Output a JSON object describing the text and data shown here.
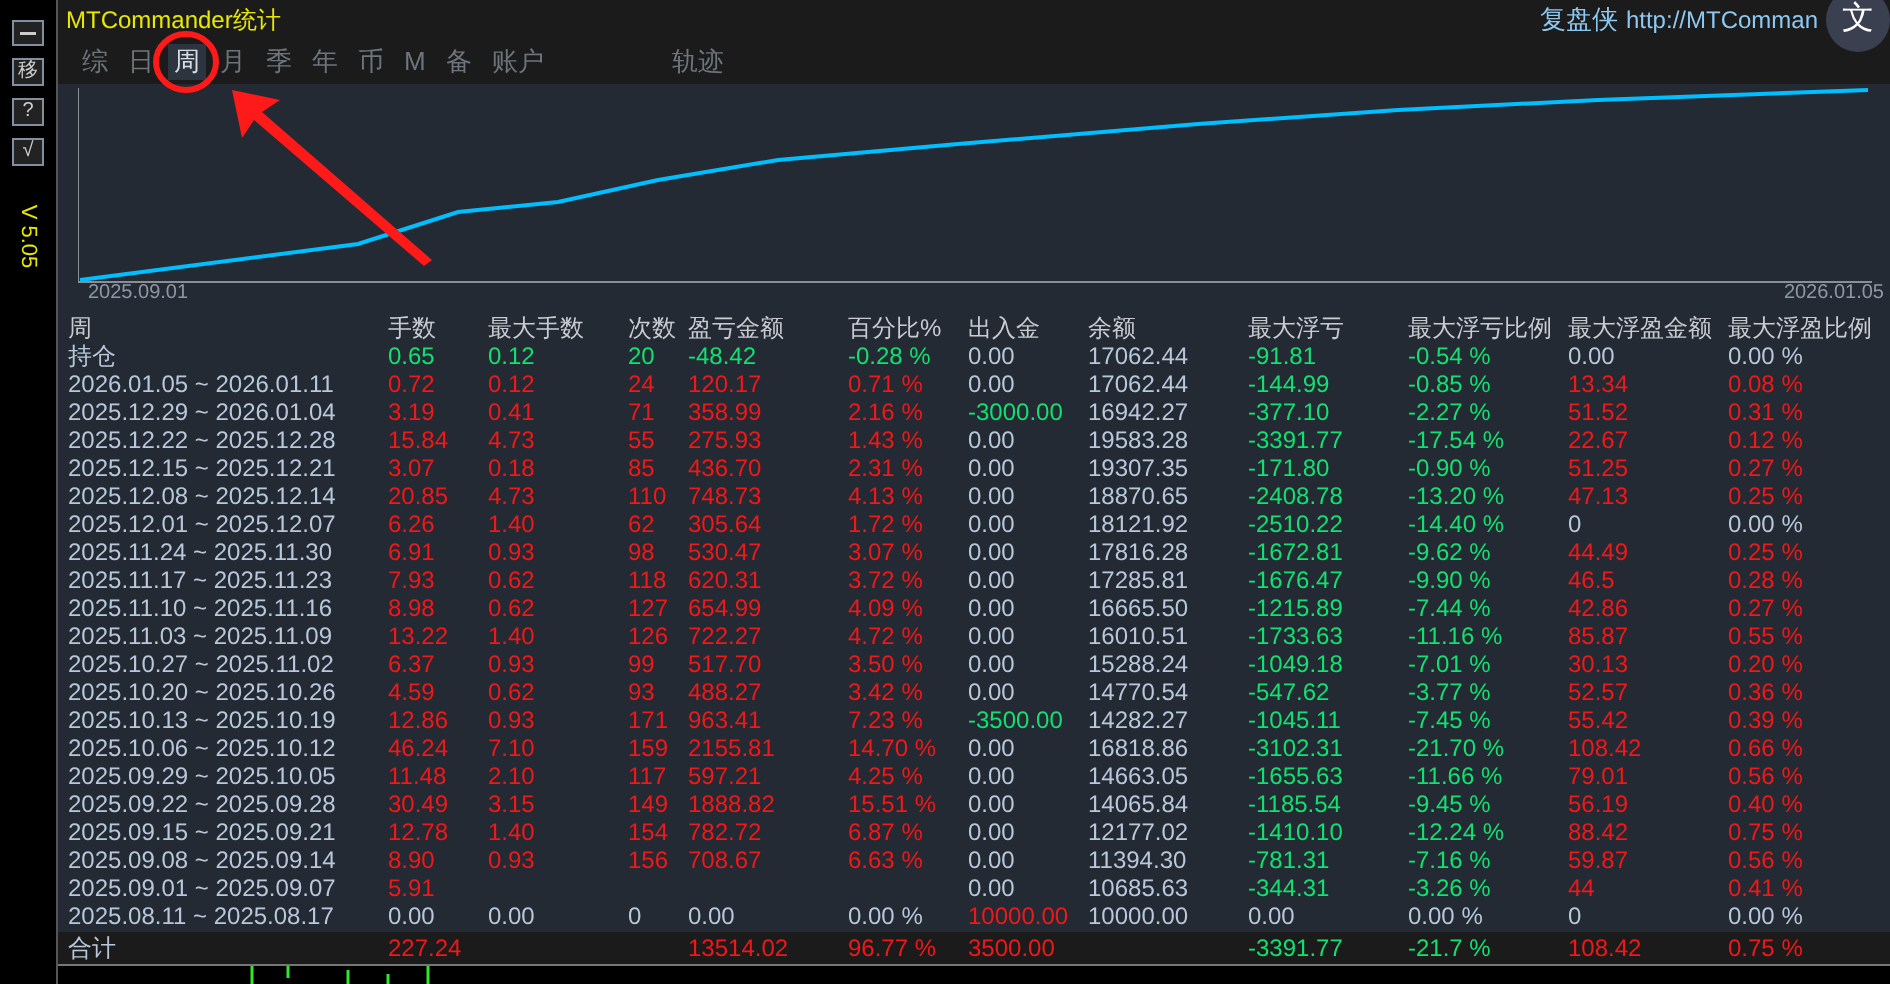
{
  "window": {
    "title": "MTCommander统计"
  },
  "sidebar": {
    "buttons": [
      "移",
      "?",
      "√"
    ],
    "version": "V 5.05"
  },
  "header_link": {
    "brand": "复盘侠",
    "url": "http://MTComman"
  },
  "translate_button": {
    "label": "文"
  },
  "tabs": [
    {
      "label": "综",
      "selected": false
    },
    {
      "label": "日",
      "selected": false
    },
    {
      "label": "周",
      "selected": true
    },
    {
      "label": "月",
      "selected": false
    },
    {
      "label": "季",
      "selected": false
    },
    {
      "label": "年",
      "selected": false
    },
    {
      "label": "币",
      "selected": false
    },
    {
      "label": "M",
      "selected": false
    },
    {
      "label": "备",
      "selected": false
    },
    {
      "label": "账户",
      "selected": false
    }
  ],
  "side_tabs": [
    {
      "label": "轨迹",
      "selected": false
    }
  ],
  "chart": {
    "x_start": "2025.09.01",
    "x_end": "2026.01.05"
  },
  "table": {
    "columns": [
      "周",
      "手数",
      "最大手数",
      "次数",
      "盈亏金额",
      "百分比%",
      "出入金",
      "余额",
      "最大浮亏",
      "最大浮亏比例",
      "最大浮盈金额",
      "最大浮盈比例"
    ],
    "rows": [
      {
        "cells": [
          {
            "text": "持仓"
          },
          {
            "text": "0.65",
            "color": "#14e070"
          },
          {
            "text": "0.12",
            "color": "#14e070"
          },
          {
            "text": "20",
            "color": "#14e070"
          },
          {
            "text": "-48.42",
            "color": "#14e070"
          },
          {
            "text": "-0.28 %",
            "color": "#14e070"
          },
          {
            "text": "0.00",
            "color": "#b9c7da"
          },
          {
            "text": "17062.44",
            "color": "#b9c7da"
          },
          {
            "text": "-91.81",
            "color": "#14e070"
          },
          {
            "text": "-0.54 %",
            "color": "#14e070"
          },
          {
            "text": "0.00",
            "color": "#b9c7da"
          },
          {
            "text": "0.00 %",
            "color": "#b9c7da"
          }
        ]
      },
      {
        "cells": [
          {
            "text": "2026.01.05 ~ 2026.01.11"
          },
          {
            "text": "0.72",
            "color": "#f01818"
          },
          {
            "text": "0.12",
            "color": "#f01818"
          },
          {
            "text": "24",
            "color": "#f01818"
          },
          {
            "text": "120.17",
            "color": "#f01818"
          },
          {
            "text": "0.71 %",
            "color": "#f01818"
          },
          {
            "text": "0.00",
            "color": "#b9c7da"
          },
          {
            "text": "17062.44",
            "color": "#b9c7da"
          },
          {
            "text": "-144.99",
            "color": "#14e070"
          },
          {
            "text": "-0.85 %",
            "color": "#14e070"
          },
          {
            "text": "13.34",
            "color": "#f01818"
          },
          {
            "text": "0.08 %",
            "color": "#f01818"
          }
        ]
      },
      {
        "cells": [
          {
            "text": "2025.12.29 ~ 2026.01.04"
          },
          {
            "text": "3.19",
            "color": "#f01818"
          },
          {
            "text": "0.41",
            "color": "#f01818"
          },
          {
            "text": "71",
            "color": "#f01818"
          },
          {
            "text": "358.99",
            "color": "#f01818"
          },
          {
            "text": "2.16 %",
            "color": "#f01818"
          },
          {
            "text": "-3000.00",
            "color": "#14e070"
          },
          {
            "text": "16942.27",
            "color": "#b9c7da"
          },
          {
            "text": "-377.10",
            "color": "#14e070"
          },
          {
            "text": "-2.27 %",
            "color": "#14e070"
          },
          {
            "text": "51.52",
            "color": "#f01818"
          },
          {
            "text": "0.31 %",
            "color": "#f01818"
          }
        ]
      },
      {
        "cells": [
          {
            "text": "2025.12.22 ~ 2025.12.28"
          },
          {
            "text": "15.84",
            "color": "#f01818"
          },
          {
            "text": "4.73",
            "color": "#f01818"
          },
          {
            "text": "55",
            "color": "#f01818"
          },
          {
            "text": "275.93",
            "color": "#f01818"
          },
          {
            "text": "1.43 %",
            "color": "#f01818"
          },
          {
            "text": "0.00",
            "color": "#b9c7da"
          },
          {
            "text": "19583.28",
            "color": "#b9c7da"
          },
          {
            "text": "-3391.77",
            "color": "#14e070"
          },
          {
            "text": "-17.54 %",
            "color": "#14e070"
          },
          {
            "text": "22.67",
            "color": "#f01818"
          },
          {
            "text": "0.12 %",
            "color": "#f01818"
          }
        ]
      },
      {
        "cells": [
          {
            "text": "2025.12.15 ~ 2025.12.21"
          },
          {
            "text": "3.07",
            "color": "#f01818"
          },
          {
            "text": "0.18",
            "color": "#f01818"
          },
          {
            "text": "85",
            "color": "#f01818"
          },
          {
            "text": "436.70",
            "color": "#f01818"
          },
          {
            "text": "2.31 %",
            "color": "#f01818"
          },
          {
            "text": "0.00",
            "color": "#b9c7da"
          },
          {
            "text": "19307.35",
            "color": "#b9c7da"
          },
          {
            "text": "-171.80",
            "color": "#14e070"
          },
          {
            "text": "-0.90 %",
            "color": "#14e070"
          },
          {
            "text": "51.25",
            "color": "#f01818"
          },
          {
            "text": "0.27 %",
            "color": "#f01818"
          }
        ]
      },
      {
        "cells": [
          {
            "text": "2025.12.08 ~ 2025.12.14"
          },
          {
            "text": "20.85",
            "color": "#f01818"
          },
          {
            "text": "4.73",
            "color": "#f01818"
          },
          {
            "text": "110",
            "color": "#f01818"
          },
          {
            "text": "748.73",
            "color": "#f01818"
          },
          {
            "text": "4.13 %",
            "color": "#f01818"
          },
          {
            "text": "0.00",
            "color": "#b9c7da"
          },
          {
            "text": "18870.65",
            "color": "#b9c7da"
          },
          {
            "text": "-2408.78",
            "color": "#14e070"
          },
          {
            "text": "-13.20 %",
            "color": "#14e070"
          },
          {
            "text": "47.13",
            "color": "#f01818"
          },
          {
            "text": "0.25 %",
            "color": "#f01818"
          }
        ]
      },
      {
        "cells": [
          {
            "text": "2025.12.01 ~ 2025.12.07"
          },
          {
            "text": "6.26",
            "color": "#f01818"
          },
          {
            "text": "1.40",
            "color": "#f01818"
          },
          {
            "text": "62",
            "color": "#f01818"
          },
          {
            "text": "305.64",
            "color": "#f01818"
          },
          {
            "text": "1.72 %",
            "color": "#f01818"
          },
          {
            "text": "0.00",
            "color": "#b9c7da"
          },
          {
            "text": "18121.92",
            "color": "#b9c7da"
          },
          {
            "text": "-2510.22",
            "color": "#14e070"
          },
          {
            "text": "-14.40 %",
            "color": "#14e070"
          },
          {
            "text": "0",
            "color": "#b9c7da"
          },
          {
            "text": "0.00 %",
            "color": "#b9c7da"
          }
        ]
      },
      {
        "cells": [
          {
            "text": "2025.11.24 ~ 2025.11.30"
          },
          {
            "text": "6.91",
            "color": "#f01818"
          },
          {
            "text": "0.93",
            "color": "#f01818"
          },
          {
            "text": "98",
            "color": "#f01818"
          },
          {
            "text": "530.47",
            "color": "#f01818"
          },
          {
            "text": "3.07 %",
            "color": "#f01818"
          },
          {
            "text": "0.00",
            "color": "#b9c7da"
          },
          {
            "text": "17816.28",
            "color": "#b9c7da"
          },
          {
            "text": "-1672.81",
            "color": "#14e070"
          },
          {
            "text": "-9.62 %",
            "color": "#14e070"
          },
          {
            "text": "44.49",
            "color": "#f01818"
          },
          {
            "text": "0.25 %",
            "color": "#f01818"
          }
        ]
      },
      {
        "cells": [
          {
            "text": "2025.11.17 ~ 2025.11.23"
          },
          {
            "text": "7.93",
            "color": "#f01818"
          },
          {
            "text": "0.62",
            "color": "#f01818"
          },
          {
            "text": "118",
            "color": "#f01818"
          },
          {
            "text": "620.31",
            "color": "#f01818"
          },
          {
            "text": "3.72 %",
            "color": "#f01818"
          },
          {
            "text": "0.00",
            "color": "#b9c7da"
          },
          {
            "text": "17285.81",
            "color": "#b9c7da"
          },
          {
            "text": "-1676.47",
            "color": "#14e070"
          },
          {
            "text": "-9.90 %",
            "color": "#14e070"
          },
          {
            "text": "46.5",
            "color": "#f01818"
          },
          {
            "text": "0.28 %",
            "color": "#f01818"
          }
        ]
      },
      {
        "cells": [
          {
            "text": "2025.11.10 ~ 2025.11.16"
          },
          {
            "text": "8.98",
            "color": "#f01818"
          },
          {
            "text": "0.62",
            "color": "#f01818"
          },
          {
            "text": "127",
            "color": "#f01818"
          },
          {
            "text": "654.99",
            "color": "#f01818"
          },
          {
            "text": "4.09 %",
            "color": "#f01818"
          },
          {
            "text": "0.00",
            "color": "#b9c7da"
          },
          {
            "text": "16665.50",
            "color": "#b9c7da"
          },
          {
            "text": "-1215.89",
            "color": "#14e070"
          },
          {
            "text": "-7.44 %",
            "color": "#14e070"
          },
          {
            "text": "42.86",
            "color": "#f01818"
          },
          {
            "text": "0.27 %",
            "color": "#f01818"
          }
        ]
      },
      {
        "cells": [
          {
            "text": "2025.11.03 ~ 2025.11.09"
          },
          {
            "text": "13.22",
            "color": "#f01818"
          },
          {
            "text": "1.40",
            "color": "#f01818"
          },
          {
            "text": "126",
            "color": "#f01818"
          },
          {
            "text": "722.27",
            "color": "#f01818"
          },
          {
            "text": "4.72 %",
            "color": "#f01818"
          },
          {
            "text": "0.00",
            "color": "#b9c7da"
          },
          {
            "text": "16010.51",
            "color": "#b9c7da"
          },
          {
            "text": "-1733.63",
            "color": "#14e070"
          },
          {
            "text": "-11.16 %",
            "color": "#14e070"
          },
          {
            "text": "85.87",
            "color": "#f01818"
          },
          {
            "text": "0.55 %",
            "color": "#f01818"
          }
        ]
      },
      {
        "cells": [
          {
            "text": "2025.10.27 ~ 2025.11.02"
          },
          {
            "text": "6.37",
            "color": "#f01818"
          },
          {
            "text": "0.93",
            "color": "#f01818"
          },
          {
            "text": "99",
            "color": "#f01818"
          },
          {
            "text": "517.70",
            "color": "#f01818"
          },
          {
            "text": "3.50 %",
            "color": "#f01818"
          },
          {
            "text": "0.00",
            "color": "#b9c7da"
          },
          {
            "text": "15288.24",
            "color": "#b9c7da"
          },
          {
            "text": "-1049.18",
            "color": "#14e070"
          },
          {
            "text": "-7.01 %",
            "color": "#14e070"
          },
          {
            "text": "30.13",
            "color": "#f01818"
          },
          {
            "text": "0.20 %",
            "color": "#f01818"
          }
        ]
      },
      {
        "cells": [
          {
            "text": "2025.10.20 ~ 2025.10.26"
          },
          {
            "text": "4.59",
            "color": "#f01818"
          },
          {
            "text": "0.62",
            "color": "#f01818"
          },
          {
            "text": "93",
            "color": "#f01818"
          },
          {
            "text": "488.27",
            "color": "#f01818"
          },
          {
            "text": "3.42 %",
            "color": "#f01818"
          },
          {
            "text": "0.00",
            "color": "#b9c7da"
          },
          {
            "text": "14770.54",
            "color": "#b9c7da"
          },
          {
            "text": "-547.62",
            "color": "#14e070"
          },
          {
            "text": "-3.77 %",
            "color": "#14e070"
          },
          {
            "text": "52.57",
            "color": "#f01818"
          },
          {
            "text": "0.36 %",
            "color": "#f01818"
          }
        ]
      },
      {
        "cells": [
          {
            "text": "2025.10.13 ~ 2025.10.19"
          },
          {
            "text": "12.86",
            "color": "#f01818"
          },
          {
            "text": "0.93",
            "color": "#f01818"
          },
          {
            "text": "171",
            "color": "#f01818"
          },
          {
            "text": "963.41",
            "color": "#f01818"
          },
          {
            "text": "7.23 %",
            "color": "#f01818"
          },
          {
            "text": "-3500.00",
            "color": "#14e070"
          },
          {
            "text": "14282.27",
            "color": "#b9c7da"
          },
          {
            "text": "-1045.11",
            "color": "#14e070"
          },
          {
            "text": "-7.45 %",
            "color": "#14e070"
          },
          {
            "text": "55.42",
            "color": "#f01818"
          },
          {
            "text": "0.39 %",
            "color": "#f01818"
          }
        ]
      },
      {
        "cells": [
          {
            "text": "2025.10.06 ~ 2025.10.12"
          },
          {
            "text": "46.24",
            "color": "#f01818"
          },
          {
            "text": "7.10",
            "color": "#f01818"
          },
          {
            "text": "159",
            "color": "#f01818"
          },
          {
            "text": "2155.81",
            "color": "#f01818"
          },
          {
            "text": "14.70 %",
            "color": "#f01818"
          },
          {
            "text": "0.00",
            "color": "#b9c7da"
          },
          {
            "text": "16818.86",
            "color": "#b9c7da"
          },
          {
            "text": "-3102.31",
            "color": "#14e070"
          },
          {
            "text": "-21.70 %",
            "color": "#14e070"
          },
          {
            "text": "108.42",
            "color": "#f01818"
          },
          {
            "text": "0.66 %",
            "color": "#f01818"
          }
        ]
      },
      {
        "cells": [
          {
            "text": "2025.09.29 ~ 2025.10.05"
          },
          {
            "text": "11.48",
            "color": "#f01818"
          },
          {
            "text": "2.10",
            "color": "#f01818"
          },
          {
            "text": "117",
            "color": "#f01818"
          },
          {
            "text": "597.21",
            "color": "#f01818"
          },
          {
            "text": "4.25 %",
            "color": "#f01818"
          },
          {
            "text": "0.00",
            "color": "#b9c7da"
          },
          {
            "text": "14663.05",
            "color": "#b9c7da"
          },
          {
            "text": "-1655.63",
            "color": "#14e070"
          },
          {
            "text": "-11.66 %",
            "color": "#14e070"
          },
          {
            "text": "79.01",
            "color": "#f01818"
          },
          {
            "text": "0.56 %",
            "color": "#f01818"
          }
        ]
      },
      {
        "cells": [
          {
            "text": "2025.09.22 ~ 2025.09.28"
          },
          {
            "text": "30.49",
            "color": "#f01818"
          },
          {
            "text": "3.15",
            "color": "#f01818"
          },
          {
            "text": "149",
            "color": "#f01818"
          },
          {
            "text": "1888.82",
            "color": "#f01818"
          },
          {
            "text": "15.51 %",
            "color": "#f01818"
          },
          {
            "text": "0.00",
            "color": "#b9c7da"
          },
          {
            "text": "14065.84",
            "color": "#b9c7da"
          },
          {
            "text": "-1185.54",
            "color": "#14e070"
          },
          {
            "text": "-9.45 %",
            "color": "#14e070"
          },
          {
            "text": "56.19",
            "color": "#f01818"
          },
          {
            "text": "0.40 %",
            "color": "#f01818"
          }
        ]
      },
      {
        "cells": [
          {
            "text": "2025.09.15 ~ 2025.09.21"
          },
          {
            "text": "12.78",
            "color": "#f01818"
          },
          {
            "text": "1.40",
            "color": "#f01818"
          },
          {
            "text": "154",
            "color": "#f01818"
          },
          {
            "text": "782.72",
            "color": "#f01818"
          },
          {
            "text": "6.87 %",
            "color": "#f01818"
          },
          {
            "text": "0.00",
            "color": "#b9c7da"
          },
          {
            "text": "12177.02",
            "color": "#b9c7da"
          },
          {
            "text": "-1410.10",
            "color": "#14e070"
          },
          {
            "text": "-12.24 %",
            "color": "#14e070"
          },
          {
            "text": "88.42",
            "color": "#f01818"
          },
          {
            "text": "0.75 %",
            "color": "#f01818"
          }
        ]
      },
      {
        "cells": [
          {
            "text": "2025.09.08 ~ 2025.09.14"
          },
          {
            "text": "8.90",
            "color": "#f01818"
          },
          {
            "text": "0.93",
            "color": "#f01818"
          },
          {
            "text": "156",
            "color": "#f01818"
          },
          {
            "text": "708.67",
            "color": "#f01818"
          },
          {
            "text": "6.63 %",
            "color": "#f01818"
          },
          {
            "text": "0.00",
            "color": "#b9c7da"
          },
          {
            "text": "11394.30",
            "color": "#b9c7da"
          },
          {
            "text": "-781.31",
            "color": "#14e070"
          },
          {
            "text": "-7.16 %",
            "color": "#14e070"
          },
          {
            "text": "59.87",
            "color": "#f01818"
          },
          {
            "text": "0.56 %",
            "color": "#f01818"
          }
        ]
      },
      {
        "cells": [
          {
            "text": "2025.09.01 ~ 2025.09.07"
          },
          {
            "text": "5.91",
            "color": "#f01818"
          },
          null,
          null,
          null,
          null,
          {
            "text": "0.00",
            "color": "#b9c7da"
          },
          {
            "text": "10685.63",
            "color": "#b9c7da"
          },
          {
            "text": "-344.31",
            "color": "#14e070"
          },
          {
            "text": "-3.26 %",
            "color": "#14e070"
          },
          {
            "text": "44",
            "color": "#f01818"
          },
          {
            "text": "0.41 %",
            "color": "#f01818"
          }
        ]
      },
      {
        "cells": [
          {
            "text": "2025.08.11 ~ 2025.08.17"
          },
          {
            "text": "0.00",
            "color": "#b9c7da"
          },
          {
            "text": "0.00",
            "color": "#b9c7da"
          },
          {
            "text": "0",
            "color": "#b9c7da"
          },
          {
            "text": "0.00",
            "color": "#b9c7da"
          },
          {
            "text": "0.00 %",
            "color": "#b9c7da"
          },
          {
            "text": "10000.00",
            "color": "#f01818"
          },
          {
            "text": "10000.00",
            "color": "#b9c7da"
          },
          {
            "text": "0.00",
            "color": "#b9c7da"
          },
          {
            "text": "0.00 %",
            "color": "#b9c7da"
          },
          {
            "text": "0",
            "color": "#b9c7da"
          },
          {
            "text": "0.00 %",
            "color": "#b9c7da"
          }
        ]
      }
    ],
    "total": {
      "cells": [
        {
          "text": "合计"
        },
        {
          "text": "227.24",
          "color": "#f01818"
        },
        null,
        null,
        {
          "text": "13514.02",
          "color": "#f01818"
        },
        {
          "text": "96.77 %",
          "color": "#f01818"
        },
        {
          "text": "3500.00",
          "color": "#f01818"
        },
        null,
        {
          "text": "-3391.77",
          "color": "#14e070"
        },
        {
          "text": "-21.7 %",
          "color": "#14e070"
        },
        {
          "text": "108.42",
          "color": "#f01818"
        },
        {
          "text": "0.75 %",
          "color": "#f01818"
        }
      ]
    }
  }
}
